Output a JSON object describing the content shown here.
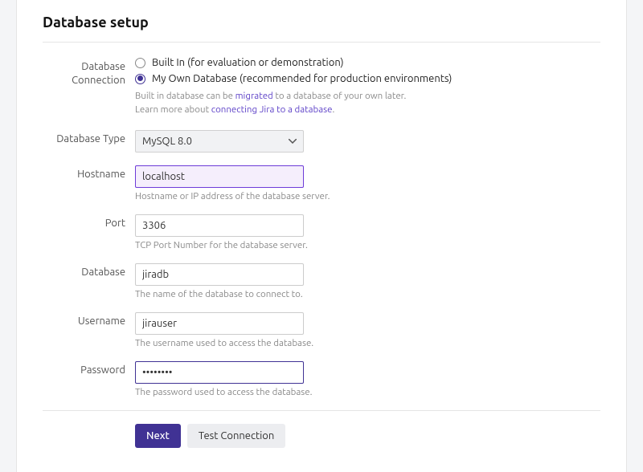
{
  "title": "Database setup",
  "connection": {
    "label": "Database Connection",
    "options": {
      "builtIn": "Built In (for evaluation or demonstration)",
      "own": "My Own Database (recommended for production environments)"
    },
    "hint1_pre": "Built in database can be ",
    "hint1_link": "migrated",
    "hint1_post": " to a database of your own later.",
    "hint2_pre": "Learn more about ",
    "hint2_link": "connecting Jira to a database",
    "hint2_post": "."
  },
  "fields": {
    "dbType": {
      "label": "Database Type",
      "value": "MySQL 8.0"
    },
    "hostname": {
      "label": "Hostname",
      "value": "localhost",
      "hint": "Hostname or IP address of the database server."
    },
    "port": {
      "label": "Port",
      "value": "3306",
      "hint": "TCP Port Number for the database server."
    },
    "database": {
      "label": "Database",
      "value": "jiradb",
      "hint": "The name of the database to connect to."
    },
    "username": {
      "label": "Username",
      "value": "jirauser",
      "hint": "The username used to access the database."
    },
    "password": {
      "label": "Password",
      "value": "••••••••",
      "hint": "The password used to access the database."
    }
  },
  "actions": {
    "next": "Next",
    "test": "Test Connection"
  }
}
